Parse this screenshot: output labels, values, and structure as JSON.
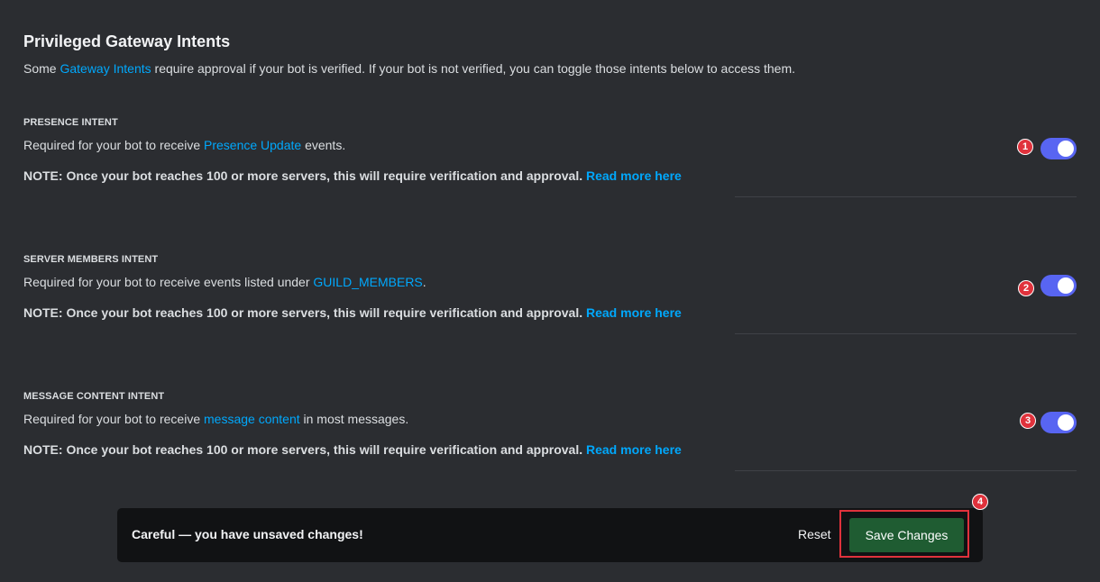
{
  "header": {
    "title": "Privileged Gateway Intents",
    "subtitle_before": "Some ",
    "subtitle_link": "Gateway Intents",
    "subtitle_after": " require approval if your bot is verified. If your bot is not verified, you can toggle those intents below to access them."
  },
  "intents": [
    {
      "heading": "PRESENCE INTENT",
      "desc_before": "Required for your bot to receive ",
      "desc_link": "Presence Update",
      "desc_after": " events.",
      "note": "NOTE: Once your bot reaches 100 or more servers, this will require verification and approval.",
      "note_link": "Read more here",
      "enabled": true,
      "marker": "1"
    },
    {
      "heading": "SERVER MEMBERS INTENT",
      "desc_before": "Required for your bot to receive events listed under ",
      "desc_link": "GUILD_MEMBERS",
      "desc_after": ".",
      "note": "NOTE: Once your bot reaches 100 or more servers, this will require verification and approval.",
      "note_link": "Read more here",
      "enabled": true,
      "marker": "2"
    },
    {
      "heading": "MESSAGE CONTENT INTENT",
      "desc_before": "Required for your bot to receive ",
      "desc_link": "message content",
      "desc_after": " in most messages.",
      "note": "NOTE: Once your bot reaches 100 or more servers, this will require verification and approval.",
      "note_link": "Read more here",
      "enabled": true,
      "marker": "3"
    }
  ],
  "unsaved_bar": {
    "message": "Careful — you have unsaved changes!",
    "reset_label": "Reset",
    "save_label": "Save Changes",
    "marker": "4"
  },
  "colors": {
    "background": "#2b2d31",
    "link": "#00a8fc",
    "toggle_on": "#5865f2",
    "save_button": "#1f5c32",
    "annotation": "#e0323c"
  }
}
